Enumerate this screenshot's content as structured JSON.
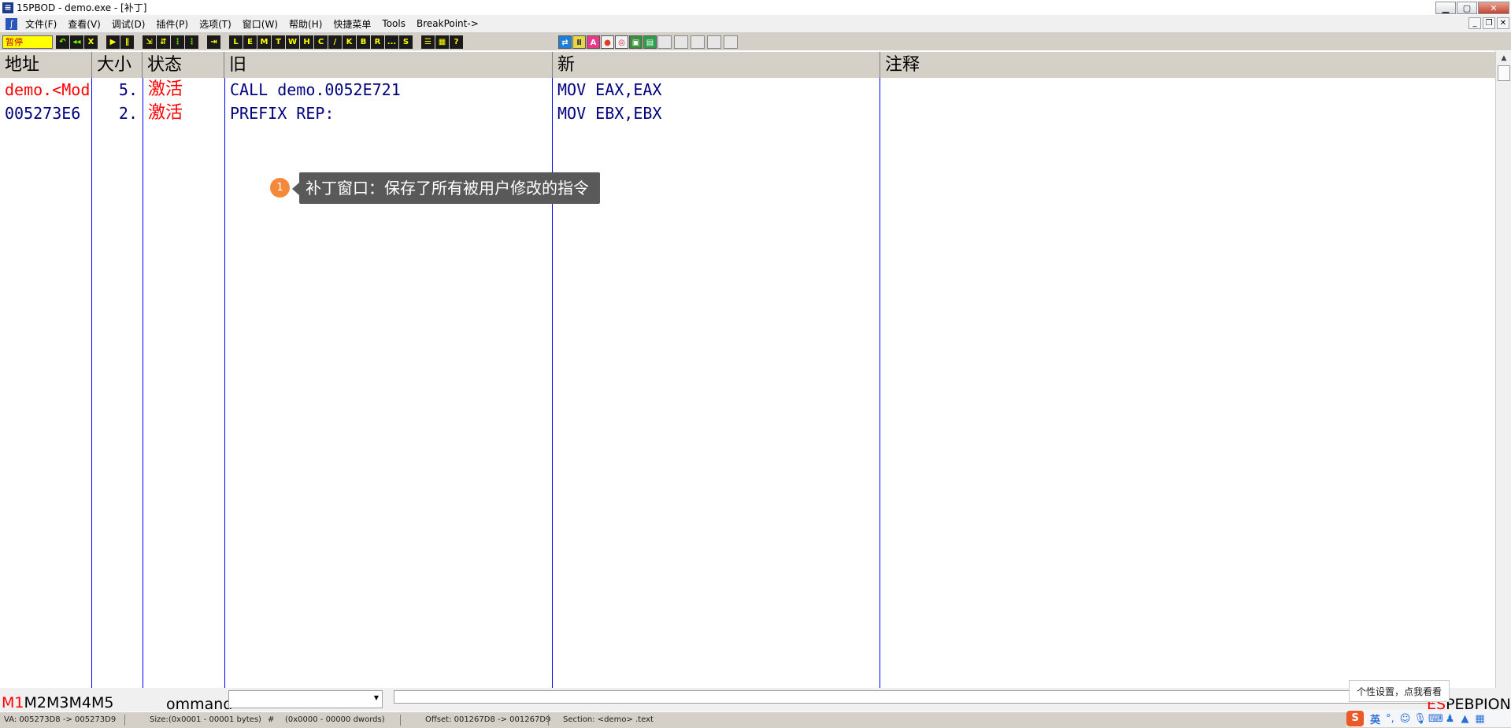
{
  "window": {
    "title": "15PBOD  - demo.exe - [补丁]",
    "app_icon": "app-logo-icon",
    "controls": [
      "minimize-icon",
      "maximize-icon",
      "close-icon"
    ]
  },
  "menu": {
    "items": [
      "文件(F)",
      "查看(V)",
      "调试(D)",
      "插件(P)",
      "选项(T)",
      "窗口(W)",
      "帮助(H)",
      "快捷菜单",
      "Tools",
      "BreakPoint->"
    ]
  },
  "toolbar": {
    "state_label": "暂停",
    "group1": [
      "open-icon",
      "restart-icon",
      "close-process-icon"
    ],
    "group2": [
      "run-icon",
      "pause-icon"
    ],
    "group3": [
      "step-into-icon",
      "step-over-icon",
      "trace-into-icon",
      "trace-over-icon"
    ],
    "group4": [
      "execute-till-return-icon"
    ],
    "letters": [
      "L",
      "E",
      "M",
      "T",
      "W",
      "H",
      "C",
      "/",
      "K",
      "B",
      "R",
      "...",
      "S"
    ],
    "group6": [
      "appearance-icon",
      "options-icon",
      "help-icon"
    ],
    "group7": [
      "plugin-1-icon",
      "plugin-2-icon",
      "plugin-a-icon",
      "plugin-record-icon",
      "plugin-target-icon",
      "plugin-image-icon",
      "plugin-patch-icon",
      "plugin-blank-1-icon",
      "plugin-blank-2-icon",
      "plugin-blank-3-icon",
      "plugin-blank-4-icon",
      "plugin-blank-5-icon"
    ]
  },
  "table": {
    "columns": [
      "地址",
      "大小",
      "状态",
      "旧",
      "新",
      "注释"
    ],
    "rows": [
      {
        "address": "demo.<Mod",
        "size": "5.",
        "state": "激活",
        "old": "CALL demo.0052E721",
        "new": "MOV EAX,EAX",
        "comment": "",
        "address_color": "#ff0000"
      },
      {
        "address": "005273E6",
        "size": "2.",
        "state": "激活",
        "old": "PREFIX REP:",
        "new": "MOV EBX,EBX",
        "comment": "",
        "address_color": "#000080"
      }
    ]
  },
  "annotation": {
    "number": "1",
    "text": "补丁窗口：保存了所有被用户修改的指令"
  },
  "command_bar": {
    "tabs": [
      "M1",
      "M2",
      "M3",
      "M4",
      "M5"
    ],
    "active_tab": "M1",
    "label": "ommand",
    "input_value": "",
    "flags_red": "ES",
    "flags_black": "PEBPIONI"
  },
  "status_bar": {
    "va": "VA: 005273D8 -> 005273D9",
    "size": "Size:(0x0001 - 00001 bytes)",
    "hash": "#",
    "dwords": "(0x0000 - 00000 dwords)",
    "offset": "Offset: 001267D8 -> 001267D9",
    "section": "Section: <demo> .text"
  },
  "ime": {
    "tooltip": "个性设置，点我看看",
    "logo": "S",
    "mode": "英",
    "icons": [
      "punctuation-icon",
      "emoji-icon",
      "microphone-icon",
      "keyboard-icon",
      "skin-icon",
      "toolbox-icon",
      "grid-icon"
    ]
  },
  "colors": {
    "accent_blue": "#0000ff",
    "text_red": "#ff0000",
    "text_navy": "#000080",
    "toolbar_bg": "#d4d0c8",
    "tooltip_bg": "#595959",
    "marker": "#f5893b"
  }
}
